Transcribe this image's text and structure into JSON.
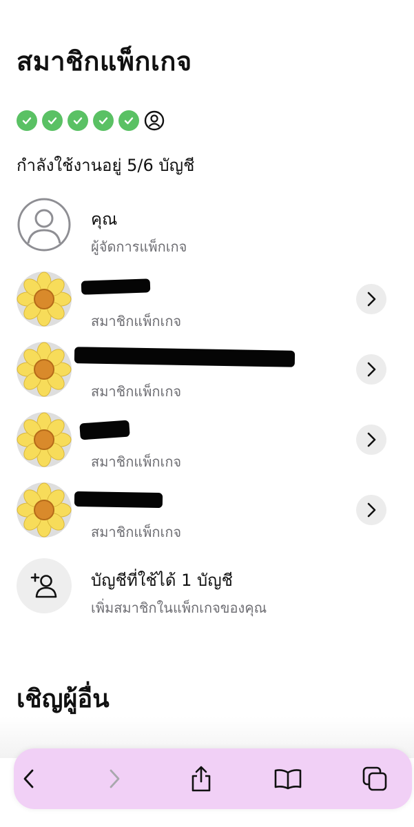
{
  "header": {
    "title": "สมาชิกแพ็กเกจ"
  },
  "slots": {
    "used": 5,
    "total": 6
  },
  "usage": {
    "text": "กำลังใช้งานอยู่ 5/6 บัญชี"
  },
  "members": [
    {
      "name": "คุณ",
      "role": "ผู้จัดการแพ็กเกจ",
      "avatar": "person-outline-icon"
    },
    {
      "name": "",
      "role": "สมาชิกแพ็กเกจ",
      "avatar": "sunflower"
    },
    {
      "name": "",
      "role": "สมาชิกแพ็กเกจ",
      "avatar": "sunflower"
    },
    {
      "name": "",
      "role": "สมาชิกแพ็กเกจ",
      "avatar": "sunflower"
    },
    {
      "name": "",
      "role": "สมาชิกแพ็กเกจ",
      "avatar": "sunflower"
    }
  ],
  "add_member": {
    "title": "บัญชีที่ใช้ได้ 1 บัญชี",
    "subtitle": "เพิ่มสมาชิกในแพ็กเกจของคุณ"
  },
  "invite": {
    "title": "เชิญผู้อื่น"
  },
  "colors": {
    "check_green": "#5ac164",
    "toolbar_tint": "#f0cdf5",
    "secondary_text": "#6e6e73"
  },
  "toolbar": {
    "buttons": [
      "back-icon",
      "forward-icon",
      "share-icon",
      "bookmarks-icon",
      "tabs-icon"
    ]
  }
}
